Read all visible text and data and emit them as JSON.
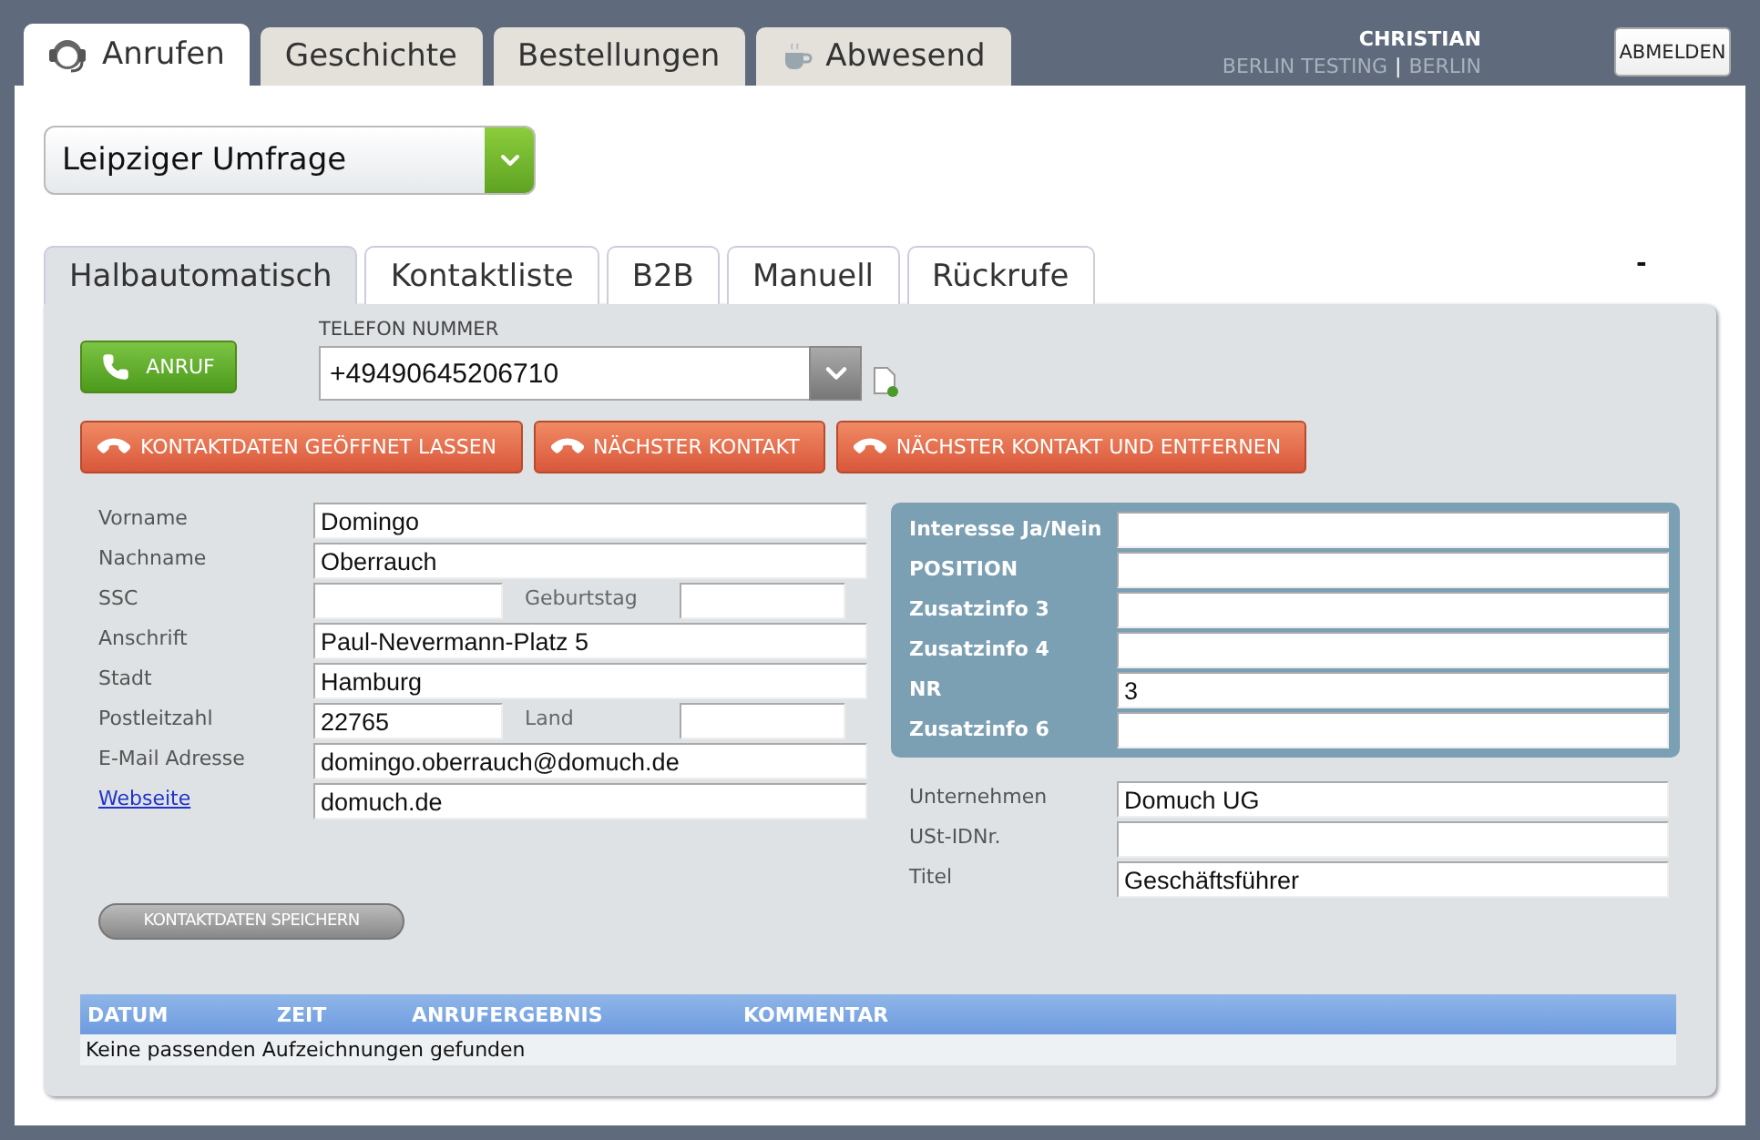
{
  "top_tabs": [
    {
      "label": "Anrufen",
      "kind": "headset",
      "selected": true
    },
    {
      "label": "Geschichte",
      "kind": "plain",
      "selected": false
    },
    {
      "label": "Bestellungen",
      "kind": "plain",
      "selected": false
    },
    {
      "label": "Abwesend",
      "kind": "cup",
      "selected": false
    }
  ],
  "user": {
    "name": "CHRISTIAN",
    "company": "BERLIN TESTING",
    "separator": "|",
    "city": "BERLIN"
  },
  "logout_button": "ABMELDEN",
  "campaign": "Leipziger Umfrage",
  "sub_tabs": [
    {
      "label": "Halbautomatisch",
      "selected": true
    },
    {
      "label": "Kontaktliste",
      "selected": false
    },
    {
      "label": "B2B",
      "selected": false
    },
    {
      "label": "Manuell",
      "selected": false
    },
    {
      "label": "Rückrufe",
      "selected": false
    }
  ],
  "collapse": "-",
  "call_button": "ANRUF",
  "phone": {
    "label": "TELEFON NUMMER",
    "value": "+49490645206710"
  },
  "actions": [
    "KONTAKTDATEN GEÖFFNET LASSEN",
    "NÄCHSTER KONTAKT",
    "NÄCHSTER KONTAKT UND ENTFERNEN"
  ],
  "contact_fields": [
    {
      "kind": "label",
      "label": "Vorname",
      "value": "Domingo"
    },
    {
      "kind": "label",
      "label": "Nachname",
      "value": "Oberrauch"
    },
    {
      "kind": "label",
      "label": "SSC",
      "second": {
        "label": "Geburtstag"
      }
    },
    {
      "kind": "label",
      "label": "Anschrift",
      "value": "Paul-Nevermann-Platz 5"
    },
    {
      "kind": "label",
      "label": "Stadt",
      "value": "Hamburg"
    },
    {
      "kind": "label",
      "label": "Postleitzahl",
      "value": "22765",
      "second": {
        "label": "Land"
      }
    },
    {
      "kind": "label",
      "label": "E-Mail Adresse",
      "value": "domingo.oberrauch@domuch.de"
    },
    {
      "kind": "link",
      "label": "Webseite",
      "value": "domuch.de"
    }
  ],
  "extra_fields": [
    {
      "label": "Interesse Ja/Nein"
    },
    {
      "label": "POSITION"
    },
    {
      "label": "Zusatzinfo 3"
    },
    {
      "label": "Zusatzinfo 4"
    },
    {
      "label": "NR",
      "value": "3"
    },
    {
      "label": "Zusatzinfo 6"
    }
  ],
  "company_fields": [
    {
      "label": "Unternehmen",
      "value": "Domuch UG"
    },
    {
      "label": "USt-IDNr."
    },
    {
      "label": "Titel",
      "value": "Geschäftsführer"
    }
  ],
  "save_button": "KONTAKTDATEN SPEICHERN",
  "history": {
    "columns": [
      "DATUM",
      "ZEIT",
      "ANRUFERGEBNIS",
      "KOMMENTAR"
    ],
    "empty": "Keine passenden Aufzeichnungen gefunden"
  }
}
